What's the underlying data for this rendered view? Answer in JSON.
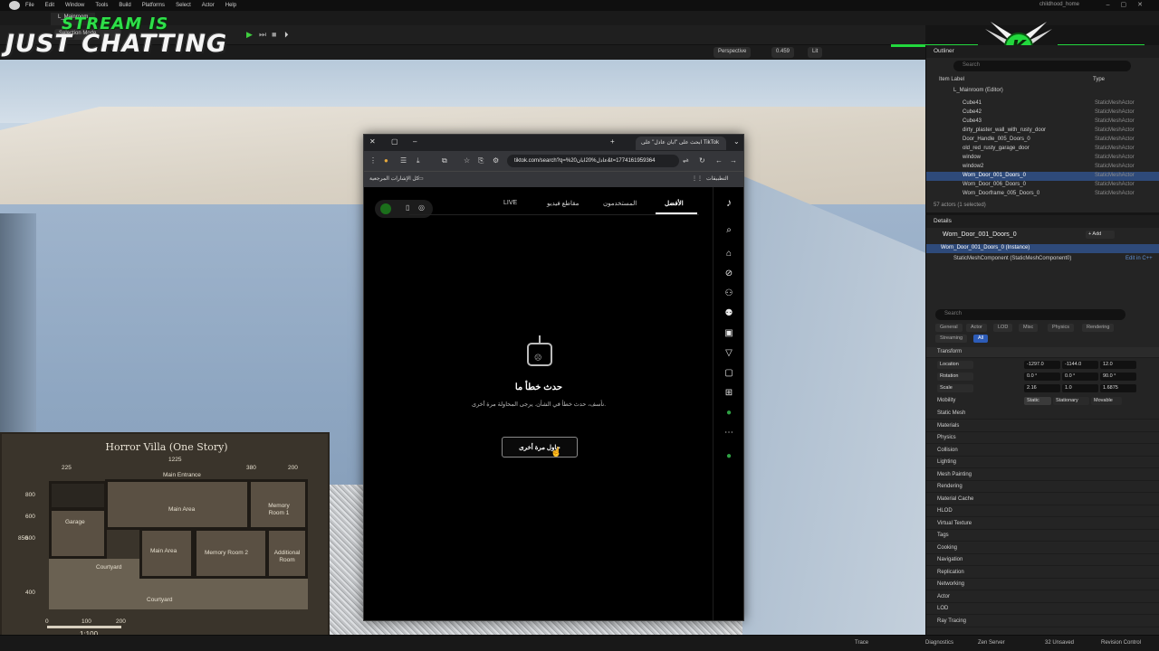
{
  "menu": {
    "items": [
      "File",
      "Edit",
      "Window",
      "Tools",
      "Build",
      "Platforms",
      "Select",
      "Actor",
      "Help"
    ],
    "project": "childhood_home"
  },
  "tab": {
    "label": "L_Mainroom"
  },
  "toolbar": {
    "selection_mode": "Selection Mode",
    "perspective": "Perspective",
    "fov": "0.459",
    "lit": "Lit"
  },
  "overlay": {
    "line1": "STREAM IS",
    "line2": "JUST CHATTING",
    "logo_letter": "K"
  },
  "floorplan": {
    "title": "Horror Villa (One Story)",
    "dims_top": [
      "225",
      "1225",
      "380",
      "200"
    ],
    "dims_left": [
      "800",
      "600",
      "850",
      "600",
      "400"
    ],
    "rooms": [
      "Main Entrance",
      "Main Area",
      "Memory Room 1",
      "Garage",
      "Main Area",
      "Memory Room 2",
      "Additional Room",
      "Courtyard",
      "Courtyard"
    ],
    "scale_ticks": [
      "0",
      "100",
      "200"
    ],
    "scale": "1:100"
  },
  "browser": {
    "tab_title": "ابحث على \"ابان عادل\" على TikTok",
    "url": "tiktok.com/search?q=%20عادل%20ابان&t=1774161959364",
    "bookmarks_apps": "التطبيقات",
    "bookmarks_all": "كل الإشارات المرجعية"
  },
  "tiktok": {
    "tabs": [
      "الأفضل",
      "المستخدمون",
      "مقاطع فيديو",
      "LIVE"
    ],
    "error_title": "حدث خطأ ما",
    "error_sub": "نأسف، حدث خطأ في الشأن. يرجى المحاولة مرة أخرى.",
    "retry": "حاول مرة أخرى"
  },
  "outliner": {
    "title": "Outliner",
    "search_placeholder": "Search",
    "col_label": "Item Label",
    "col_type": "Type",
    "root": "L_Mainroom (Editor)",
    "rows": [
      {
        "name": "Cube41",
        "type": "StaticMeshActor"
      },
      {
        "name": "Cube42",
        "type": "StaticMeshActor"
      },
      {
        "name": "Cube43",
        "type": "StaticMeshActor"
      },
      {
        "name": "dirty_plaster_wall_with_rusty_door",
        "type": "StaticMeshActor"
      },
      {
        "name": "Door_Handle_005_Doors_0",
        "type": "StaticMeshActor"
      },
      {
        "name": "old_red_rusty_garage_door",
        "type": "StaticMeshActor"
      },
      {
        "name": "window",
        "type": "StaticMeshActor"
      },
      {
        "name": "window2",
        "type": "StaticMeshActor"
      },
      {
        "name": "Worn_Door_001_Doors_0",
        "type": "StaticMeshActor"
      },
      {
        "name": "Worn_Door_006_Doors_0",
        "type": "StaticMeshActor"
      },
      {
        "name": "Worn_Doorframe_005_Doors_0",
        "type": "StaticMeshActor"
      }
    ],
    "footer": "57 actors (1 selected)"
  },
  "details": {
    "title": "Details",
    "actor": "Worn_Door_001_Doors_0",
    "add": "+ Add",
    "instance": "Worn_Door_001_Doors_0 (Instance)",
    "component": "StaticMeshComponent (StaticMeshComponent0)",
    "edit_cpp": "Edit in C++",
    "search_placeholder": "Search",
    "filters": [
      "General",
      "Actor",
      "LOD",
      "Misc",
      "Physics",
      "Rendering",
      "Streaming",
      "All"
    ],
    "transform": "Transform",
    "location_label": "Location",
    "rotation_label": "Rotation",
    "scale_label": "Scale",
    "location": [
      "-1297.0",
      "-1144.0",
      "12.0"
    ],
    "rotation": [
      "0.0 °",
      "0.0 °",
      "90.0 °"
    ],
    "scale": [
      "2.16",
      "1.0",
      "1.6875"
    ],
    "mobility_label": "Mobility",
    "mobility": [
      "Static",
      "Stationary",
      "Movable"
    ],
    "categories": [
      "Static Mesh",
      "Materials",
      "Physics",
      "Collision",
      "Lighting",
      "Mesh Painting",
      "Rendering",
      "Material Cache",
      "HLOD",
      "Virtual Texture",
      "Tags",
      "Cooking",
      "Navigation",
      "Replication",
      "Networking",
      "Actor",
      "LOD",
      "Ray Tracing"
    ]
  },
  "status": {
    "trace": "Trace",
    "diagnostics": "Diagnostics",
    "zen": "Zen Server",
    "unsaved": "32 Unsaved",
    "revision": "Revision Control"
  },
  "colors": {
    "accent_green": "#22d83d",
    "selection_blue": "#2e4a7a"
  }
}
